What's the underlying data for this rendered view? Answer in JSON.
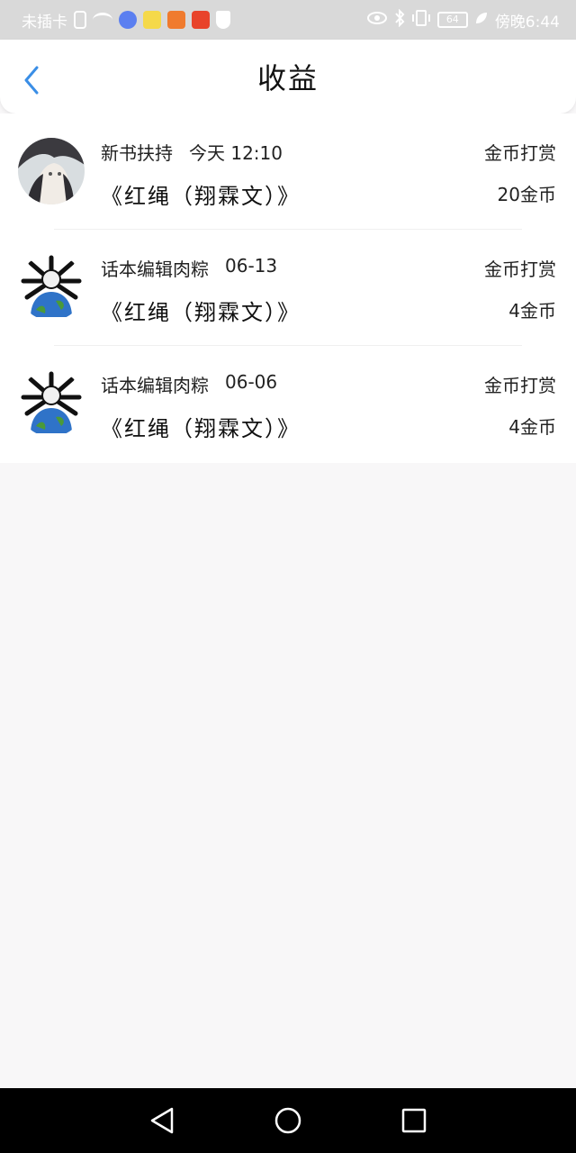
{
  "status_bar": {
    "carrier": "未插卡",
    "time": "傍晚6:44",
    "battery": "64"
  },
  "header": {
    "title": "收益"
  },
  "records": [
    {
      "source": "新书扶持",
      "time": "今天  12:10",
      "book": "《红绳（翔霖文）》",
      "type": "金币打赏",
      "amount": "20金币",
      "avatar": "anime-avatar"
    },
    {
      "source": "话本编辑肉粽",
      "time": "06-13",
      "book": "《红绳（翔霖文）》",
      "type": "金币打赏",
      "amount": "4金币",
      "avatar": "earth-avatar"
    },
    {
      "source": "话本编辑肉粽",
      "time": "06-06",
      "book": "《红绳（翔霖文）》",
      "type": "金币打赏",
      "amount": "4金币",
      "avatar": "earth-avatar"
    }
  ],
  "colors": {
    "accent": "#3a8ee6",
    "status_bar": "#d9d9d9",
    "background": "#f8f7f8"
  }
}
